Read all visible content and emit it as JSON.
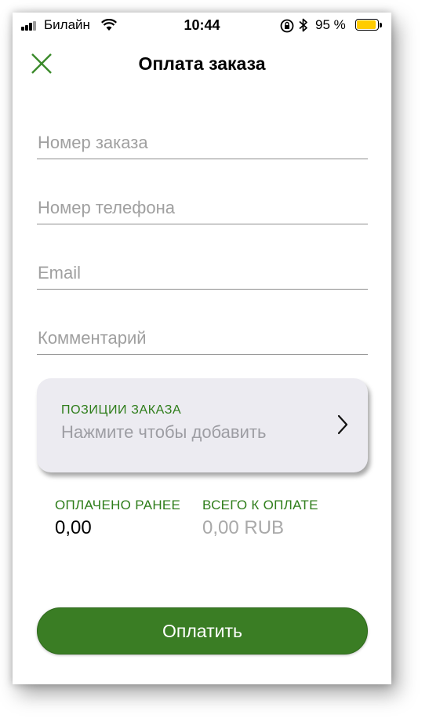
{
  "status_bar": {
    "carrier": "Билайн",
    "time": "10:44",
    "battery_percent": "95 %",
    "battery_level": 0.95
  },
  "colors": {
    "accent_green": "#3a7d24",
    "label_green": "#2e7d1a",
    "placeholder_gray": "#a0a0a0",
    "card_background": "#ecebf1",
    "battery_yellow": "#ffcc00"
  },
  "header": {
    "close_icon": "close-icon",
    "title": "Оплата заказа"
  },
  "form": {
    "order_number": {
      "placeholder": "Номер заказа",
      "value": ""
    },
    "phone": {
      "placeholder": "Номер телефона",
      "value": ""
    },
    "email": {
      "placeholder": "Email",
      "value": ""
    },
    "comment": {
      "placeholder": "Комментарий",
      "value": ""
    }
  },
  "order_items": {
    "title": "ПОЗИЦИИ ЗАКАЗА",
    "hint": "Нажмите чтобы добавить",
    "icon": "chevron-right-icon"
  },
  "totals": {
    "paid_label": "ОПЛАЧЕНО РАНЕЕ",
    "paid_value": "0,00",
    "total_label": "ВСЕГО К ОПЛАТЕ",
    "total_value": "0,00 RUB"
  },
  "pay_button": {
    "label": "Оплатить"
  }
}
